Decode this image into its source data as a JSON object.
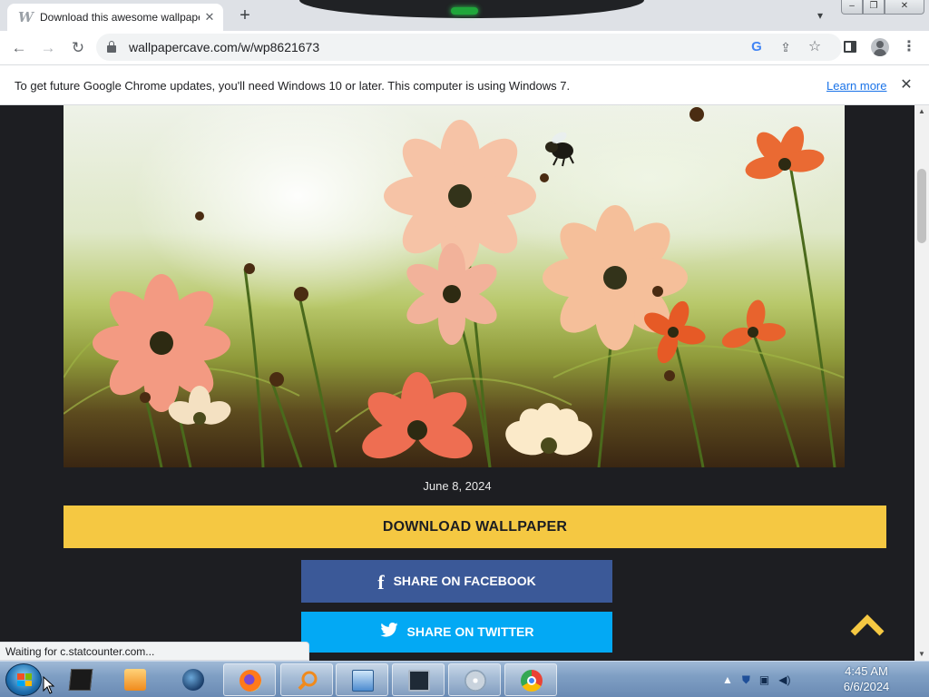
{
  "browser": {
    "tab": {
      "title": "Download this awesome wallpaper",
      "favicon": "W"
    },
    "new_tab_label": "+",
    "url": "wallpapercave.com/w/wp8621673",
    "window_buttons": {
      "minimize": "‒",
      "restore": "❐",
      "close": "✕"
    }
  },
  "infobar": {
    "message": "To get future Google Chrome updates, you'll need Windows 10 or later. This computer is using Windows 7.",
    "link": "Learn more",
    "close": "✕"
  },
  "page": {
    "wallpaper_alt": "wallpaper-cosmos-flowers-with-bee",
    "date": "June 8, 2024",
    "download_label": "DOWNLOAD WALLPAPER",
    "share_facebook": "SHARE ON FACEBOOK",
    "share_twitter": "SHARE ON TWITTER",
    "facebook_glyph": "f"
  },
  "status_bar": {
    "text": "Waiting for c.statcounter.com..."
  },
  "taskbar": {
    "apps": [
      "terminal",
      "media-player",
      "globe",
      "firefox",
      "search",
      "system-properties",
      "screen",
      "cd-player",
      "chrome"
    ],
    "active_app": "chrome",
    "clock_time": "4:45 AM",
    "clock_date": "6/6/2024"
  },
  "colors": {
    "download_button": "#f5c842",
    "facebook": "#3b5998",
    "twitter": "#03a9f4",
    "page_background": "#1d1e22",
    "accent_arrow": "#f5c842"
  }
}
